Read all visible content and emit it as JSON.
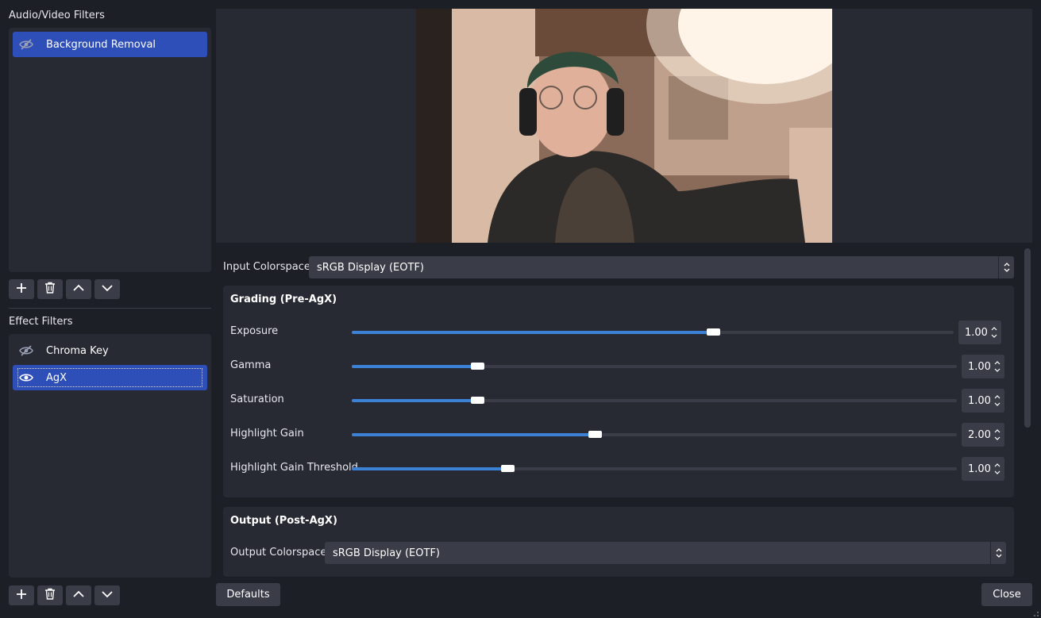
{
  "left": {
    "av_title": "Audio/Video Filters",
    "av_items": [
      {
        "label": "Background Removal",
        "visible": false,
        "selected": true
      }
    ],
    "effect_title": "Effect Filters",
    "effect_items": [
      {
        "label": "Chroma Key",
        "visible": false,
        "selected": false
      },
      {
        "label": "AgX",
        "visible": true,
        "selected": true
      }
    ],
    "toolbar_icons": [
      "plus-icon",
      "trash-icon",
      "chevron-up-icon",
      "chevron-down-icon"
    ]
  },
  "props": {
    "input_colorspace_label": "Input Colorspace",
    "input_colorspace_value": "sRGB Display (EOTF)",
    "grading_title": "Grading (Pre-AgX)",
    "sliders": [
      {
        "label": "Exposure",
        "value": "1.00",
        "fraction": 0.6
      },
      {
        "label": "Gamma",
        "value": "1.00",
        "fraction": 0.208
      },
      {
        "label": "Saturation",
        "value": "1.00",
        "fraction": 0.207
      },
      {
        "label": "Highlight Gain",
        "value": "2.00",
        "fraction": 0.402
      },
      {
        "label": "Highlight Gain Threshold",
        "value": "1.00",
        "fraction": 0.257
      }
    ],
    "output_title": "Output (Post-AgX)",
    "output_colorspace_label": "Output Colorspace",
    "output_colorspace_value": "sRGB Display (EOTF)"
  },
  "buttons": {
    "defaults": "Defaults",
    "close": "Close"
  },
  "colors": {
    "accent": "#3b82d6",
    "selection": "#2f4fb8",
    "panel": "#272a33",
    "background": "#1d1f26"
  }
}
